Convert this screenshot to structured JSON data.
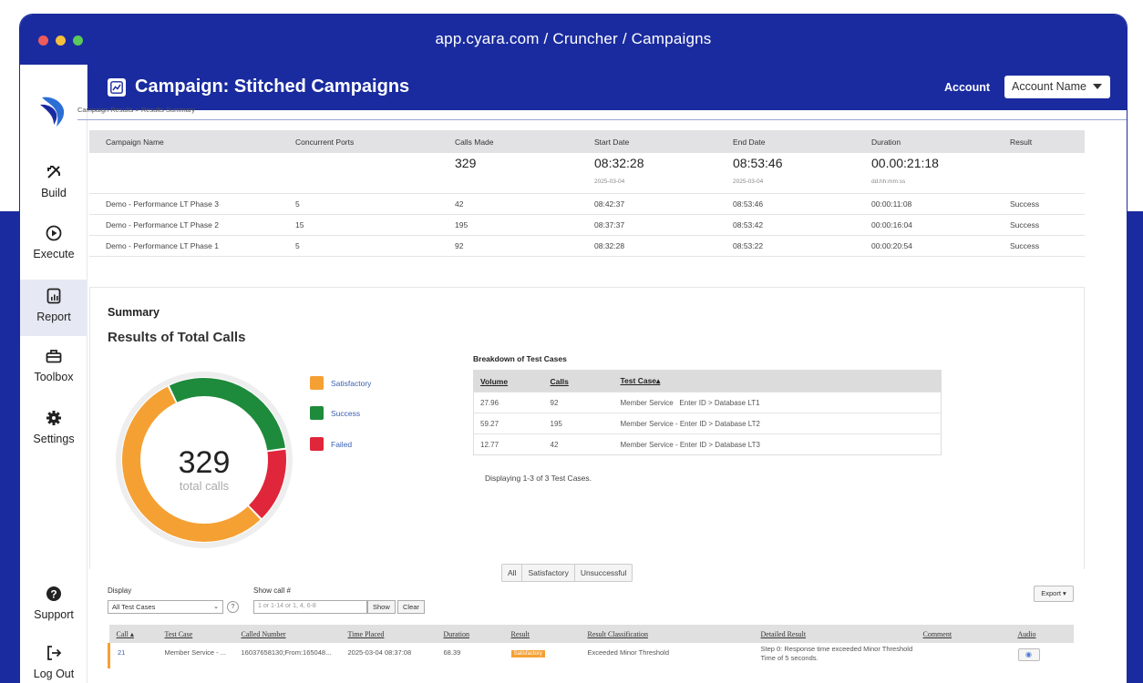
{
  "window": {
    "url": "app.cyara.com / Cruncher / Campaigns",
    "dots": [
      "#ee5b5b",
      "#f4bf3a",
      "#5bc85b"
    ]
  },
  "sidebar": {
    "items": [
      {
        "label": "Build",
        "icon": "build-icon"
      },
      {
        "label": "Execute",
        "icon": "play-circle-icon"
      },
      {
        "label": "Report",
        "icon": "report-icon"
      },
      {
        "label": "Toolbox",
        "icon": "toolbox-icon"
      },
      {
        "label": "Settings",
        "icon": "gear-icon"
      },
      {
        "label": "Support",
        "icon": "help-circle-icon"
      },
      {
        "label": "Log Out",
        "icon": "logout-icon"
      }
    ],
    "active": "Report"
  },
  "header": {
    "title": "Campaign: Stitched Campaigns",
    "account_label": "Account",
    "account_value": "Account Name"
  },
  "breadcrumb": "Campaign Results > Results Summary",
  "campaign_table": {
    "headers": [
      "Campaign Name",
      "Concurrent Ports",
      "Calls Made",
      "Start Date",
      "End Date",
      "Duration",
      "Result"
    ],
    "totals": {
      "calls": "329",
      "start_time": "08:32:28",
      "start_date": "2025-03-04",
      "end_time": "08:53:46",
      "end_date": "2025-03-04",
      "duration": "00.00:21:18",
      "duration_format": "dd.hh:mm:ss"
    },
    "rows": [
      [
        "Demo - Performance LT Phase 3",
        "5",
        "42",
        "08:42:37",
        "08:53:46",
        "00:00:11:08",
        "Success"
      ],
      [
        "Demo - Performance LT Phase 2",
        "15",
        "195",
        "08:37:37",
        "08:53:42",
        "00:00:16:04",
        "Success"
      ],
      [
        "Demo - Performance LT Phase 1",
        "5",
        "92",
        "08:32:28",
        "08:53:22",
        "00:00:20:54",
        "Success"
      ]
    ]
  },
  "summary": {
    "title": "Summary",
    "results_title": "Results of Total Calls",
    "total": "329",
    "total_label": "total calls",
    "legend": [
      {
        "label": "Satisfactory",
        "color": "#f5a033"
      },
      {
        "label": "Success",
        "color": "#1e8a3c"
      },
      {
        "label": "Failed",
        "color": "#e0263a"
      }
    ],
    "donut_fractions": {
      "satisfactory": 0.55,
      "success": 0.3,
      "failed": 0.15
    }
  },
  "breakdown": {
    "title": "Breakdown of Test Cases",
    "headers": [
      "Volume",
      "Calls",
      "Test Case▴"
    ],
    "rows": [
      [
        "27.96",
        "92",
        "Member Service   Enter ID > Database LT1"
      ],
      [
        "59.27",
        "195",
        "Member Service - Enter ID > Database LT2"
      ],
      [
        "12.77",
        "42",
        "Member Service - Enter ID > Database LT3"
      ]
    ],
    "displaying": "Displaying 1-3 of 3 Test Cases."
  },
  "filter_tabs": [
    "All",
    "Satisfactory",
    "Unsuccessful"
  ],
  "controls": {
    "display_label": "Display",
    "display_value": "All Test Cases",
    "help": "?",
    "show_call_label": "Show call #",
    "show_call_placeholder": "1 or 1-14 or 1, 4, 6-8",
    "show_button": "Show",
    "clear_button": "Clear",
    "export_button": "Export ▾"
  },
  "calls_table": {
    "headers": [
      "Call ▴",
      "Test Case",
      "Called Number",
      "Time Placed",
      "Duration",
      "Result",
      "Result Classification",
      "Detailed Result",
      "Comment",
      "Audio"
    ],
    "rows": [
      {
        "call": "21",
        "test_case": "Member Service - ...",
        "called_number": "16037658130;From:165048...",
        "time_placed": "2025-03-04 08:37:08",
        "duration": "68.39",
        "result": "Satisfactory",
        "classification": "Exceeded Minor Threshold",
        "detailed": "Step 0: Response time exceeded Minor Threshold Time of 5 seconds.",
        "comment": ""
      }
    ]
  }
}
